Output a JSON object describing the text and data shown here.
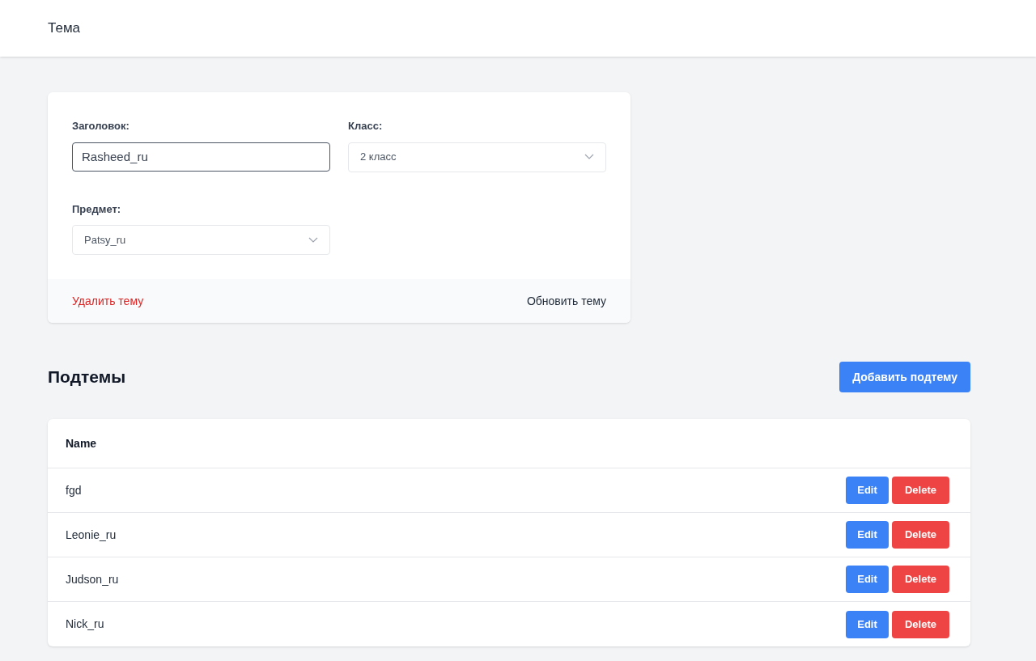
{
  "header": {
    "title": "Тема"
  },
  "form": {
    "title_field": {
      "label": "Заголовок:",
      "value": "Rasheed_ru",
      "focused": true
    },
    "class_select": {
      "label": "Класс:",
      "value": "2 класс"
    },
    "subject_select": {
      "label": "Предмет:",
      "value": "Patsy_ru"
    },
    "delete_link": "Удалить тему",
    "update_link": "Обновить тему"
  },
  "subtopics": {
    "heading": "Подтемы",
    "add_button": "Добавить подтему",
    "table": {
      "columns": [
        "Name"
      ],
      "rows": [
        {
          "name": "fgd",
          "edit": "Edit",
          "delete": "Delete"
        },
        {
          "name": "Leonie_ru",
          "edit": "Edit",
          "delete": "Delete"
        },
        {
          "name": "Judson_ru",
          "edit": "Edit",
          "delete": "Delete"
        },
        {
          "name": "Nick_ru",
          "edit": "Edit",
          "delete": "Delete"
        }
      ]
    }
  }
}
